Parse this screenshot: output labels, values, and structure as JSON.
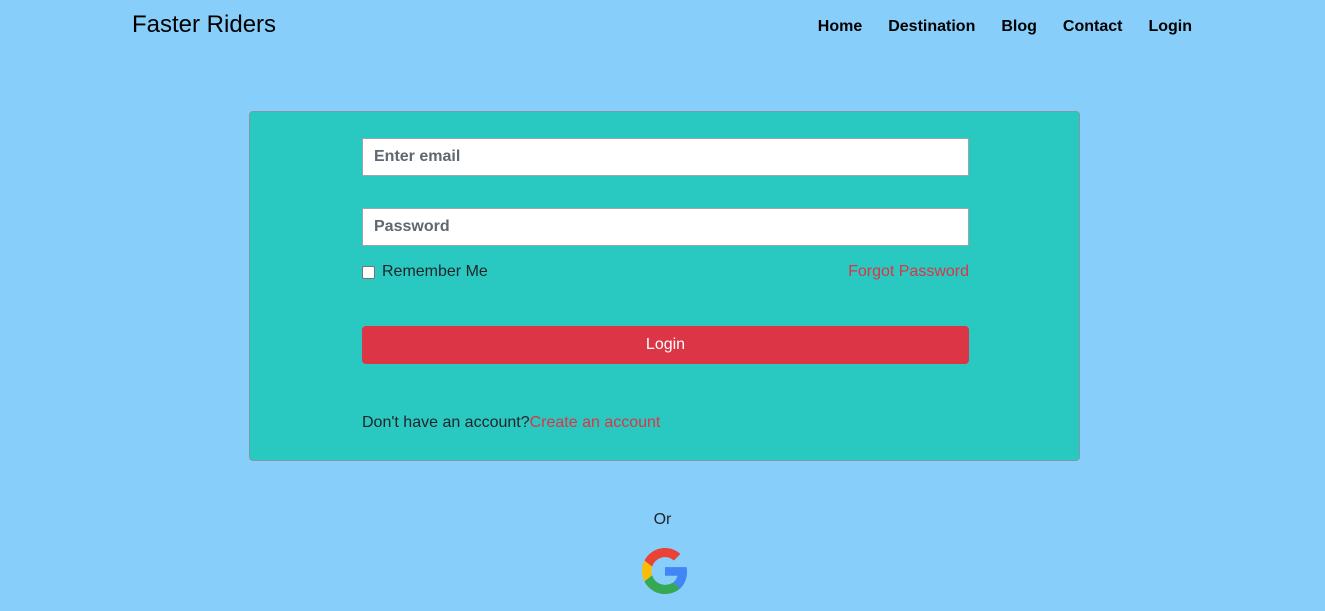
{
  "navbar": {
    "brand": "Faster Riders",
    "links": [
      "Home",
      "Destination",
      "Blog",
      "Contact",
      "Login"
    ]
  },
  "login_form": {
    "email_placeholder": "Enter email",
    "password_placeholder": "Password",
    "remember_label": "Remember Me",
    "remember_checked": false,
    "forgot_label": "Forgot Password",
    "submit_label": "Login",
    "signup_prompt": "Don't have an account?",
    "signup_link": "Create an account"
  },
  "alt_login": {
    "or_label": "Or",
    "google_icon": "google-icon"
  },
  "colors": {
    "page_background": "#87cefa",
    "card_background": "#29c9c1",
    "accent": "#dc3545"
  }
}
